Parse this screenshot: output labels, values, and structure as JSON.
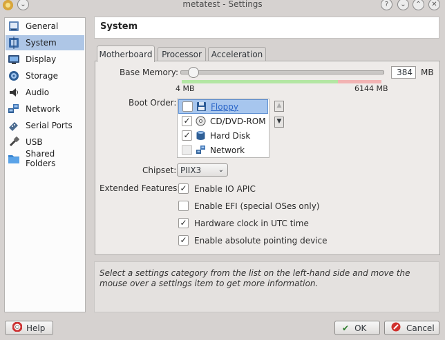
{
  "window": {
    "title": "metatest - Settings"
  },
  "sidebar": {
    "items": [
      {
        "label": "General",
        "icon": "general-icon"
      },
      {
        "label": "System",
        "icon": "system-icon",
        "selected": true
      },
      {
        "label": "Display",
        "icon": "display-icon"
      },
      {
        "label": "Storage",
        "icon": "storage-icon"
      },
      {
        "label": "Audio",
        "icon": "audio-icon"
      },
      {
        "label": "Network",
        "icon": "network-icon"
      },
      {
        "label": "Serial Ports",
        "icon": "serial-ports-icon"
      },
      {
        "label": "USB",
        "icon": "usb-icon"
      },
      {
        "label": "Shared Folders",
        "icon": "shared-folders-icon"
      }
    ]
  },
  "header": {
    "title": "System"
  },
  "tabs": [
    {
      "label": "Motherboard",
      "active": true
    },
    {
      "label": "Processor"
    },
    {
      "label": "Acceleration"
    }
  ],
  "motherboard": {
    "base_memory": {
      "label": "Base Memory:",
      "value": "384",
      "unit": "MB",
      "min_label": "4 MB",
      "max_label": "6144 MB",
      "slider_fraction": 0.062
    },
    "boot_order": {
      "label": "Boot Order:",
      "items": [
        {
          "label": "Floppy",
          "checked": false,
          "selected": true
        },
        {
          "label": "CD/DVD-ROM",
          "checked": true
        },
        {
          "label": "Hard Disk",
          "checked": true
        },
        {
          "label": "Network",
          "checked": false
        }
      ]
    },
    "chipset": {
      "label": "Chipset:",
      "value": "PIIX3"
    },
    "extended_features": {
      "label": "Extended Features:",
      "items": [
        {
          "label": "Enable IO APIC",
          "checked": true
        },
        {
          "label": "Enable EFI (special OSes only)",
          "checked": false
        },
        {
          "label": "Hardware clock in UTC time",
          "checked": true
        },
        {
          "label": "Enable absolute pointing device",
          "checked": true
        }
      ]
    }
  },
  "info": {
    "text": "Select a settings category from the list on the left-hand side and move the mouse over a settings item to get more information."
  },
  "buttons": {
    "help": "Help",
    "ok": "OK",
    "cancel": "Cancel"
  },
  "colors": {
    "selection": "#aec6e6",
    "link": "#2b66c8",
    "ok_check": "#2a7a2a",
    "cancel_red": "#d0312d"
  }
}
